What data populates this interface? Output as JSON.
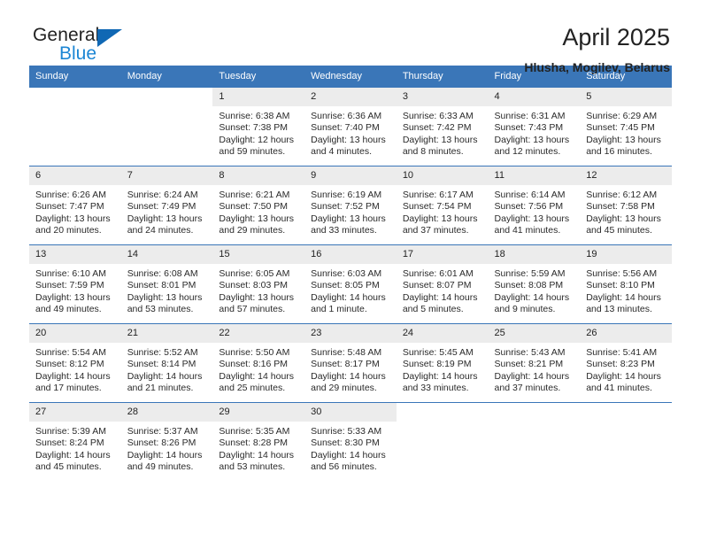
{
  "branding": {
    "name_part1": "General",
    "name_part2": "Blue",
    "triangle_color": "#1068b4",
    "blue_color": "#1c86d4"
  },
  "header": {
    "title": "April 2025",
    "subtitle": "Hlusha, Mogilev, Belarus"
  },
  "theme": {
    "header_blue": "#3a76b8",
    "daynum_gray": "#ececec",
    "text": "#222222"
  },
  "calendar": {
    "weekday_headers": [
      "Sunday",
      "Monday",
      "Tuesday",
      "Wednesday",
      "Thursday",
      "Friday",
      "Saturday"
    ],
    "weeks": [
      [
        {
          "day": "",
          "blank": true
        },
        {
          "day": "",
          "blank": true
        },
        {
          "day": "1",
          "sunrise": "Sunrise: 6:38 AM",
          "sunset": "Sunset: 7:38 PM",
          "daylight": "Daylight: 12 hours and 59 minutes."
        },
        {
          "day": "2",
          "sunrise": "Sunrise: 6:36 AM",
          "sunset": "Sunset: 7:40 PM",
          "daylight": "Daylight: 13 hours and 4 minutes."
        },
        {
          "day": "3",
          "sunrise": "Sunrise: 6:33 AM",
          "sunset": "Sunset: 7:42 PM",
          "daylight": "Daylight: 13 hours and 8 minutes."
        },
        {
          "day": "4",
          "sunrise": "Sunrise: 6:31 AM",
          "sunset": "Sunset: 7:43 PM",
          "daylight": "Daylight: 13 hours and 12 minutes."
        },
        {
          "day": "5",
          "sunrise": "Sunrise: 6:29 AM",
          "sunset": "Sunset: 7:45 PM",
          "daylight": "Daylight: 13 hours and 16 minutes."
        }
      ],
      [
        {
          "day": "6",
          "sunrise": "Sunrise: 6:26 AM",
          "sunset": "Sunset: 7:47 PM",
          "daylight": "Daylight: 13 hours and 20 minutes."
        },
        {
          "day": "7",
          "sunrise": "Sunrise: 6:24 AM",
          "sunset": "Sunset: 7:49 PM",
          "daylight": "Daylight: 13 hours and 24 minutes."
        },
        {
          "day": "8",
          "sunrise": "Sunrise: 6:21 AM",
          "sunset": "Sunset: 7:50 PM",
          "daylight": "Daylight: 13 hours and 29 minutes."
        },
        {
          "day": "9",
          "sunrise": "Sunrise: 6:19 AM",
          "sunset": "Sunset: 7:52 PM",
          "daylight": "Daylight: 13 hours and 33 minutes."
        },
        {
          "day": "10",
          "sunrise": "Sunrise: 6:17 AM",
          "sunset": "Sunset: 7:54 PM",
          "daylight": "Daylight: 13 hours and 37 minutes."
        },
        {
          "day": "11",
          "sunrise": "Sunrise: 6:14 AM",
          "sunset": "Sunset: 7:56 PM",
          "daylight": "Daylight: 13 hours and 41 minutes."
        },
        {
          "day": "12",
          "sunrise": "Sunrise: 6:12 AM",
          "sunset": "Sunset: 7:58 PM",
          "daylight": "Daylight: 13 hours and 45 minutes."
        }
      ],
      [
        {
          "day": "13",
          "sunrise": "Sunrise: 6:10 AM",
          "sunset": "Sunset: 7:59 PM",
          "daylight": "Daylight: 13 hours and 49 minutes."
        },
        {
          "day": "14",
          "sunrise": "Sunrise: 6:08 AM",
          "sunset": "Sunset: 8:01 PM",
          "daylight": "Daylight: 13 hours and 53 minutes."
        },
        {
          "day": "15",
          "sunrise": "Sunrise: 6:05 AM",
          "sunset": "Sunset: 8:03 PM",
          "daylight": "Daylight: 13 hours and 57 minutes."
        },
        {
          "day": "16",
          "sunrise": "Sunrise: 6:03 AM",
          "sunset": "Sunset: 8:05 PM",
          "daylight": "Daylight: 14 hours and 1 minute."
        },
        {
          "day": "17",
          "sunrise": "Sunrise: 6:01 AM",
          "sunset": "Sunset: 8:07 PM",
          "daylight": "Daylight: 14 hours and 5 minutes."
        },
        {
          "day": "18",
          "sunrise": "Sunrise: 5:59 AM",
          "sunset": "Sunset: 8:08 PM",
          "daylight": "Daylight: 14 hours and 9 minutes."
        },
        {
          "day": "19",
          "sunrise": "Sunrise: 5:56 AM",
          "sunset": "Sunset: 8:10 PM",
          "daylight": "Daylight: 14 hours and 13 minutes."
        }
      ],
      [
        {
          "day": "20",
          "sunrise": "Sunrise: 5:54 AM",
          "sunset": "Sunset: 8:12 PM",
          "daylight": "Daylight: 14 hours and 17 minutes."
        },
        {
          "day": "21",
          "sunrise": "Sunrise: 5:52 AM",
          "sunset": "Sunset: 8:14 PM",
          "daylight": "Daylight: 14 hours and 21 minutes."
        },
        {
          "day": "22",
          "sunrise": "Sunrise: 5:50 AM",
          "sunset": "Sunset: 8:16 PM",
          "daylight": "Daylight: 14 hours and 25 minutes."
        },
        {
          "day": "23",
          "sunrise": "Sunrise: 5:48 AM",
          "sunset": "Sunset: 8:17 PM",
          "daylight": "Daylight: 14 hours and 29 minutes."
        },
        {
          "day": "24",
          "sunrise": "Sunrise: 5:45 AM",
          "sunset": "Sunset: 8:19 PM",
          "daylight": "Daylight: 14 hours and 33 minutes."
        },
        {
          "day": "25",
          "sunrise": "Sunrise: 5:43 AM",
          "sunset": "Sunset: 8:21 PM",
          "daylight": "Daylight: 14 hours and 37 minutes."
        },
        {
          "day": "26",
          "sunrise": "Sunrise: 5:41 AM",
          "sunset": "Sunset: 8:23 PM",
          "daylight": "Daylight: 14 hours and 41 minutes."
        }
      ],
      [
        {
          "day": "27",
          "sunrise": "Sunrise: 5:39 AM",
          "sunset": "Sunset: 8:24 PM",
          "daylight": "Daylight: 14 hours and 45 minutes."
        },
        {
          "day": "28",
          "sunrise": "Sunrise: 5:37 AM",
          "sunset": "Sunset: 8:26 PM",
          "daylight": "Daylight: 14 hours and 49 minutes."
        },
        {
          "day": "29",
          "sunrise": "Sunrise: 5:35 AM",
          "sunset": "Sunset: 8:28 PM",
          "daylight": "Daylight: 14 hours and 53 minutes."
        },
        {
          "day": "30",
          "sunrise": "Sunrise: 5:33 AM",
          "sunset": "Sunset: 8:30 PM",
          "daylight": "Daylight: 14 hours and 56 minutes."
        },
        {
          "day": "",
          "blank": true
        },
        {
          "day": "",
          "blank": true
        },
        {
          "day": "",
          "blank": true
        }
      ]
    ]
  }
}
